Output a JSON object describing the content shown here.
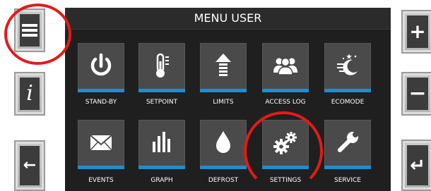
{
  "colors": {
    "screen_background": "#1f1f1f",
    "tile_background": "#4a4a4a",
    "accent_bar": "#1e8ed0",
    "highlight_ring": "#e21a1a"
  },
  "header": {
    "title": "MENU USER"
  },
  "left_buttons": [
    {
      "icon": "menu-icon"
    },
    {
      "icon": "info-icon",
      "glyph": "i"
    },
    {
      "icon": "arrow-left-icon",
      "glyph": "←"
    }
  ],
  "right_buttons": [
    {
      "icon": "plus-icon",
      "glyph": "+"
    },
    {
      "icon": "minus-icon",
      "glyph": "−"
    },
    {
      "icon": "enter-icon",
      "glyph": "↵"
    }
  ],
  "menu": {
    "items": [
      {
        "label": "STAND-BY",
        "icon": "power-icon"
      },
      {
        "label": "SETPOINT",
        "icon": "thermometer-icon"
      },
      {
        "label": "LIMITS",
        "icon": "upload-arrow-icon"
      },
      {
        "label": "ACCESS LOG",
        "icon": "users-icon"
      },
      {
        "label": "ECOMODE",
        "icon": "night-mode-icon"
      },
      {
        "label": "EVENTS",
        "icon": "envelope-icon"
      },
      {
        "label": "GRAPH",
        "icon": "bar-graph-icon"
      },
      {
        "label": "DEFROST",
        "icon": "water-drop-icon"
      },
      {
        "label": "SETTINGS",
        "icon": "gears-icon"
      },
      {
        "label": "SERVICE",
        "icon": "wrench-icon"
      }
    ]
  },
  "annotations": {
    "highlighted": [
      "menu-button",
      "settings"
    ]
  }
}
